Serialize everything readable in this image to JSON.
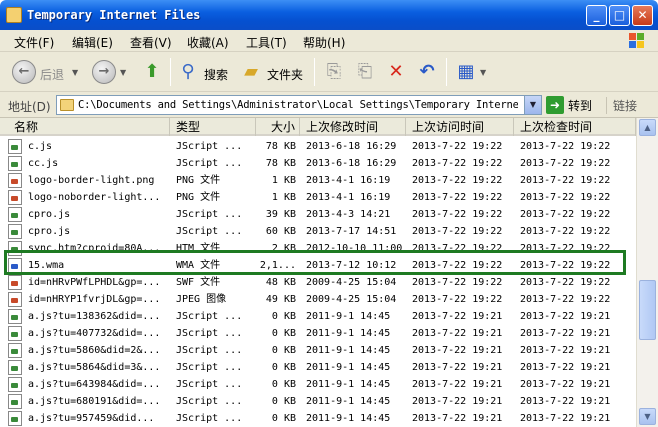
{
  "window": {
    "title": "Temporary Internet Files"
  },
  "menu": [
    "文件(F)",
    "编辑(E)",
    "查看(V)",
    "收藏(A)",
    "工具(T)",
    "帮助(H)"
  ],
  "toolbar": {
    "back": "后退",
    "search": "搜索",
    "folders": "文件夹"
  },
  "address": {
    "label": "地址(D)",
    "path": "C:\\Documents and Settings\\Administrator\\Local Settings\\Temporary Internet",
    "go": "转到",
    "links": "链接"
  },
  "columns": {
    "name": "名称",
    "type": "类型",
    "size": "大小",
    "modified": "上次修改时间",
    "accessed": "上次访问时间",
    "checked": "上次检查时间"
  },
  "files": [
    {
      "name": "c.js",
      "type": "JScript ...",
      "size": "78 KB",
      "modified": "2013-6-18 16:29",
      "accessed": "2013-7-22 19:22",
      "checked": "2013-7-22 19:22",
      "icon": "script"
    },
    {
      "name": "cc.js",
      "type": "JScript ...",
      "size": "78 KB",
      "modified": "2013-6-18 16:29",
      "accessed": "2013-7-22 19:22",
      "checked": "2013-7-22 19:22",
      "icon": "script"
    },
    {
      "name": "logo-border-light.png",
      "type": "PNG 文件",
      "size": "1 KB",
      "modified": "2013-4-1 16:19",
      "accessed": "2013-7-22 19:22",
      "checked": "2013-7-22 19:22",
      "icon": "img"
    },
    {
      "name": "logo-noborder-light...",
      "type": "PNG 文件",
      "size": "1 KB",
      "modified": "2013-4-1 16:19",
      "accessed": "2013-7-22 19:22",
      "checked": "2013-7-22 19:22",
      "icon": "img"
    },
    {
      "name": "cpro.js",
      "type": "JScript ...",
      "size": "39 KB",
      "modified": "2013-4-3 14:21",
      "accessed": "2013-7-22 19:22",
      "checked": "2013-7-22 19:22",
      "icon": "script"
    },
    {
      "name": "cpro.js",
      "type": "JScript ...",
      "size": "60 KB",
      "modified": "2013-7-17 14:51",
      "accessed": "2013-7-22 19:22",
      "checked": "2013-7-22 19:22",
      "icon": "script"
    },
    {
      "name": "sync.htm?cproid=80A...",
      "type": "HTM 文件",
      "size": "2 KB",
      "modified": "2012-10-10 11:00",
      "accessed": "2013-7-22 19:22",
      "checked": "2013-7-22 19:22",
      "icon": "script"
    },
    {
      "name": "15.wma",
      "type": "WMA 文件",
      "size": "2,1...",
      "modified": "2013-7-12 10:12",
      "accessed": "2013-7-22 19:22",
      "checked": "2013-7-22 19:22",
      "icon": "media"
    },
    {
      "name": "id=nHRvPWfLPHDL&gp=...",
      "type": "SWF 文件",
      "size": "48 KB",
      "modified": "2009-4-25 15:04",
      "accessed": "2013-7-22 19:22",
      "checked": "2013-7-22 19:22",
      "icon": "img"
    },
    {
      "name": "id=nHRYP1fvrjDL&gp=...",
      "type": "JPEG 图像",
      "size": "49 KB",
      "modified": "2009-4-25 15:04",
      "accessed": "2013-7-22 19:22",
      "checked": "2013-7-22 19:22",
      "icon": "img"
    },
    {
      "name": "a.js?tu=138362&did=...",
      "type": "JScript ...",
      "size": "0 KB",
      "modified": "2011-9-1 14:45",
      "accessed": "2013-7-22 19:21",
      "checked": "2013-7-22 19:21",
      "icon": "script"
    },
    {
      "name": "a.js?tu=407732&did=...",
      "type": "JScript ...",
      "size": "0 KB",
      "modified": "2011-9-1 14:45",
      "accessed": "2013-7-22 19:21",
      "checked": "2013-7-22 19:21",
      "icon": "script"
    },
    {
      "name": "a.js?tu=5860&did=2&...",
      "type": "JScript ...",
      "size": "0 KB",
      "modified": "2011-9-1 14:45",
      "accessed": "2013-7-22 19:21",
      "checked": "2013-7-22 19:21",
      "icon": "script"
    },
    {
      "name": "a.js?tu=5864&did=3&...",
      "type": "JScript ...",
      "size": "0 KB",
      "modified": "2011-9-1 14:45",
      "accessed": "2013-7-22 19:21",
      "checked": "2013-7-22 19:21",
      "icon": "script"
    },
    {
      "name": "a.js?tu=643984&did=...",
      "type": "JScript ...",
      "size": "0 KB",
      "modified": "2011-9-1 14:45",
      "accessed": "2013-7-22 19:21",
      "checked": "2013-7-22 19:21",
      "icon": "script"
    },
    {
      "name": "a.js?tu=680191&did=...",
      "type": "JScript ...",
      "size": "0 KB",
      "modified": "2011-9-1 14:45",
      "accessed": "2013-7-22 19:21",
      "checked": "2013-7-22 19:21",
      "icon": "script"
    },
    {
      "name": "a.js?tu=957459&did...",
      "type": "JScript ...",
      "size": "0 KB",
      "modified": "2011-9-1 14:45",
      "accessed": "2013-7-22 19:21",
      "checked": "2013-7-22 19:21",
      "icon": "script"
    }
  ]
}
